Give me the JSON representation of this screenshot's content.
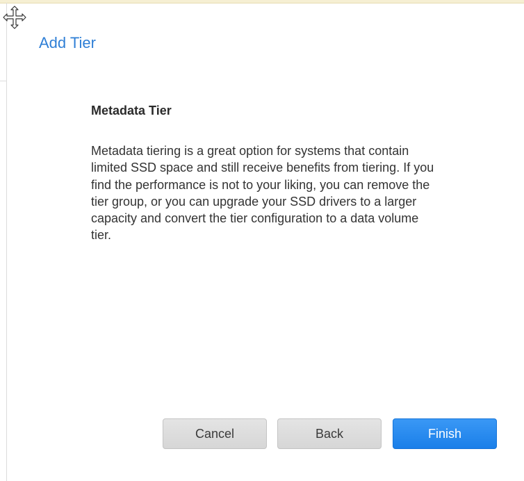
{
  "dialog": {
    "title": "Add Tier",
    "move_handle_icon": "move-arrows-icon"
  },
  "content": {
    "heading": "Metadata Tier",
    "description": "Metadata tiering is a great option for systems that contain limited SSD space and still receive benefits from tiering. If you find the performance is not to your liking, you can remove the tier group, or you can upgrade your SSD drivers to a larger capacity and convert the tier configuration to a data volume tier."
  },
  "buttons": {
    "cancel_label": "Cancel",
    "back_label": "Back",
    "finish_label": "Finish"
  },
  "colors": {
    "title": "#2f7fd6",
    "primary_button": "#1a7fe9",
    "secondary_button": "#dcdcdc"
  }
}
